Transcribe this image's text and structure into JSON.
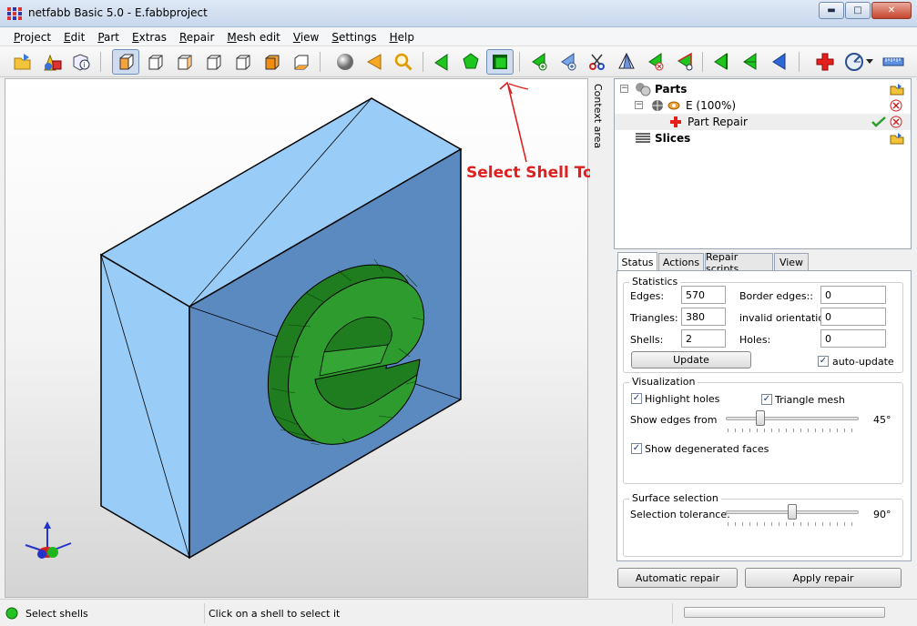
{
  "window": {
    "title": "netfabb Basic 5.0 - E.fabbproject",
    "minimize": "▬",
    "maximize": "□",
    "close": "✕"
  },
  "menu": [
    {
      "label": "Project",
      "accel": "P",
      "rest": "roject"
    },
    {
      "label": "Edit",
      "accel": "E",
      "rest": "dit"
    },
    {
      "label": "Part",
      "accel": "P",
      "rest": "art"
    },
    {
      "label": "Extras",
      "accel": "E",
      "rest": "xtras"
    },
    {
      "label": "Repair",
      "accel": "R",
      "rest": "epair"
    },
    {
      "label": "Mesh edit",
      "accel": "M",
      "rest": "esh edit"
    },
    {
      "label": "View",
      "accel": "V",
      "rest": "iew"
    },
    {
      "label": "Settings",
      "accel": "S",
      "rest": "ettings"
    },
    {
      "label": "Help",
      "accel": "H",
      "rest": "elp"
    }
  ],
  "annotation": "Select Shell Tool",
  "context_area": "Context area",
  "tree": {
    "parts": "Parts",
    "part_e": "E (100%)",
    "part_repair": "Part Repair",
    "slices": "Slices"
  },
  "tabs": [
    "Status",
    "Actions",
    "Repair scripts",
    "View"
  ],
  "statistics": {
    "title": "Statistics",
    "edges_label": "Edges:",
    "edges": "570",
    "triangles_label": "Triangles:",
    "triangles": "380",
    "shells_label": "Shells:",
    "shells": "2",
    "border_edges_label": "Border edges::",
    "border_edges": "0",
    "invalid_orientation_label": "invalid orientation:",
    "invalid_orientation": "0",
    "holes_label": "Holes:",
    "holes": "0",
    "update": "Update",
    "auto_update": "auto-update"
  },
  "visualization": {
    "title": "Visualization",
    "highlight_holes": "Highlight holes",
    "triangle_mesh": "Triangle mesh",
    "show_edges_from": "Show edges from",
    "edges_angle": "45°",
    "show_degenerated": "Show degenerated faces"
  },
  "surface": {
    "title": "Surface selection",
    "tolerance_label": "Selection tolerance:",
    "tolerance_value": "90°"
  },
  "buttons": {
    "automatic_repair": "Automatic repair",
    "apply_repair": "Apply repair"
  },
  "status": {
    "mode": "Select shells",
    "hint": "Click on a shell to select it"
  },
  "colors": {
    "box_light": "#99ccf7",
    "box_dark": "#5b8ac0",
    "shell_green": "#2e9b2e",
    "annotation_red": "#e02020"
  }
}
